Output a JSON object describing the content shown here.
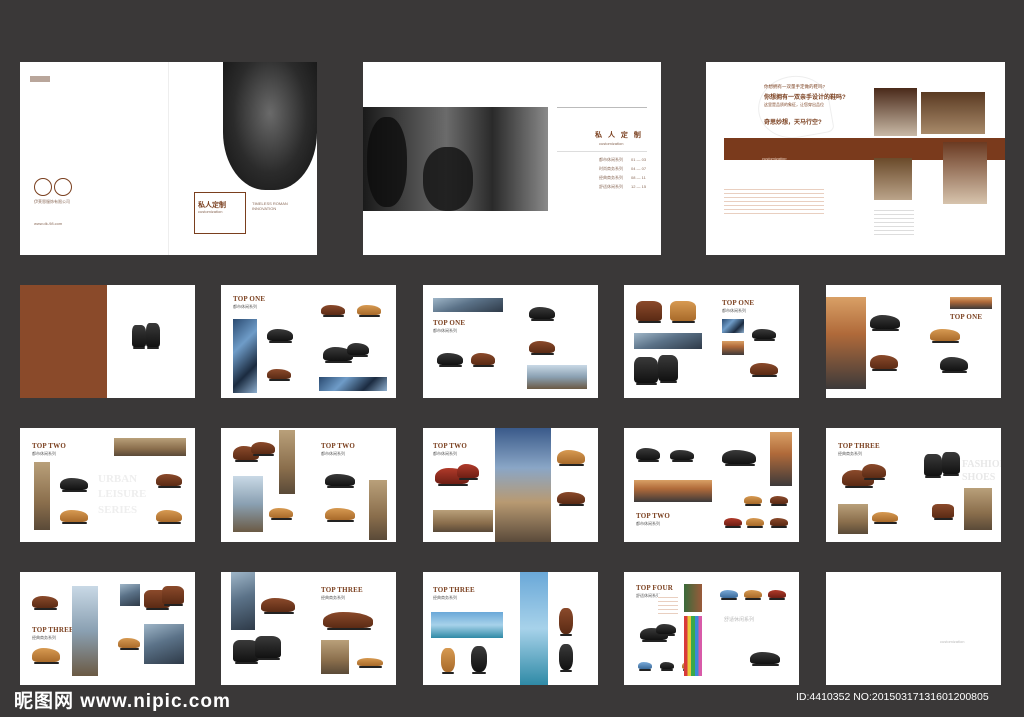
{
  "cover": {
    "title": "私人定制",
    "subtitle": "customization",
    "side_text": "TIMELESS ROMAN INNOVATION",
    "company": "伊莱恩服饰有限公司",
    "website": "www.dk-98.com"
  },
  "toc": {
    "title": "私 人 定 制",
    "subtitle": "customization",
    "items": [
      "都市休闲系列",
      "时尚商务系列",
      "经典商务系列",
      "舒适休闲系列"
    ],
    "numbers": [
      "01 — 03",
      "04 — 07",
      "08 — 11",
      "12 — 15"
    ]
  },
  "intro": {
    "q1": "你想拥有一双量手定做的鞋吗?",
    "q2": "你想拥有一双亲手设计的鞋吗?",
    "q3": "这里是品质的象征，让您穿出品位",
    "q4": "奇思妙想，天马行空?",
    "band": "customization"
  },
  "pages": {
    "top_one": "TOP ONE",
    "top_one_sub": "都市休闲系列",
    "top_two": "TOP TWO",
    "top_two_sub": "都市休闲系列",
    "top_three": "TOP THREE",
    "top_three_sub": "经典商务系列",
    "top_four": "TOP FOUR",
    "top_four_sub": "舒适休闲系列",
    "urban_series": [
      "URBAN",
      "LEISURE",
      "SERIES"
    ],
    "fashion_shoes": [
      "FASHION",
      "SHOES"
    ],
    "blank_caption": "customization"
  },
  "watermark": {
    "site": "昵图网 www.nipic.com",
    "id": "ID:4410352 NO:20150317131601200805"
  }
}
